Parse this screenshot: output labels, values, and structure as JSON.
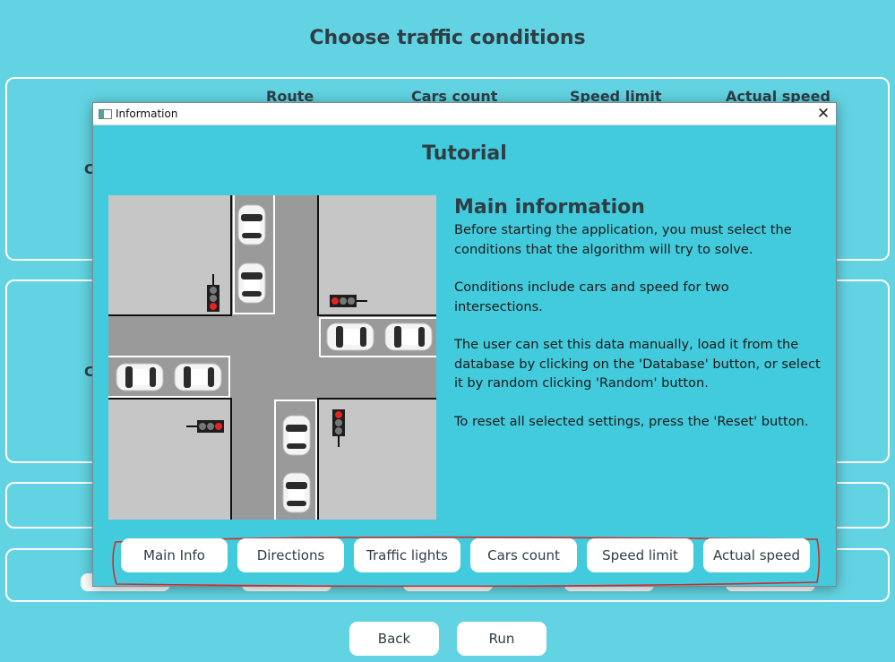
{
  "background": {
    "title": "Choose traffic conditions",
    "headers": [
      "Route",
      "Cars count",
      "Speed limit",
      "Actual speed"
    ],
    "side_letters": [
      "C",
      "C"
    ],
    "back_label": "Back",
    "run_label": "Run"
  },
  "dialog": {
    "window_title": "Information",
    "close_glyph": "✕",
    "tutorial_title": "Tutorial",
    "heading": "Main information",
    "paragraphs": [
      "Before starting the application, you must select the conditions that the algorithm will try to solve.",
      "Conditions include cars and speed for two intersections.",
      "The user can set this data manually, load it from the database by clicking on the 'Database' button, or select it by random clicking 'Random' button.",
      "To reset all selected settings, press the 'Reset' button."
    ],
    "tabs": [
      "Main Info",
      "Directions",
      "Traffic lights",
      "Cars count",
      "Speed limit",
      "Actual speed"
    ]
  },
  "colors": {
    "background": "#62d3e2",
    "dialog_background": "#42cbdc",
    "road": "#9a9a9a",
    "sidewalk": "#c6c6c6",
    "annotation": "#d22a2a",
    "light_red": "#e52222"
  },
  "icons": [
    "app-icon",
    "close-icon",
    "car-icon",
    "traffic-light-icon"
  ]
}
